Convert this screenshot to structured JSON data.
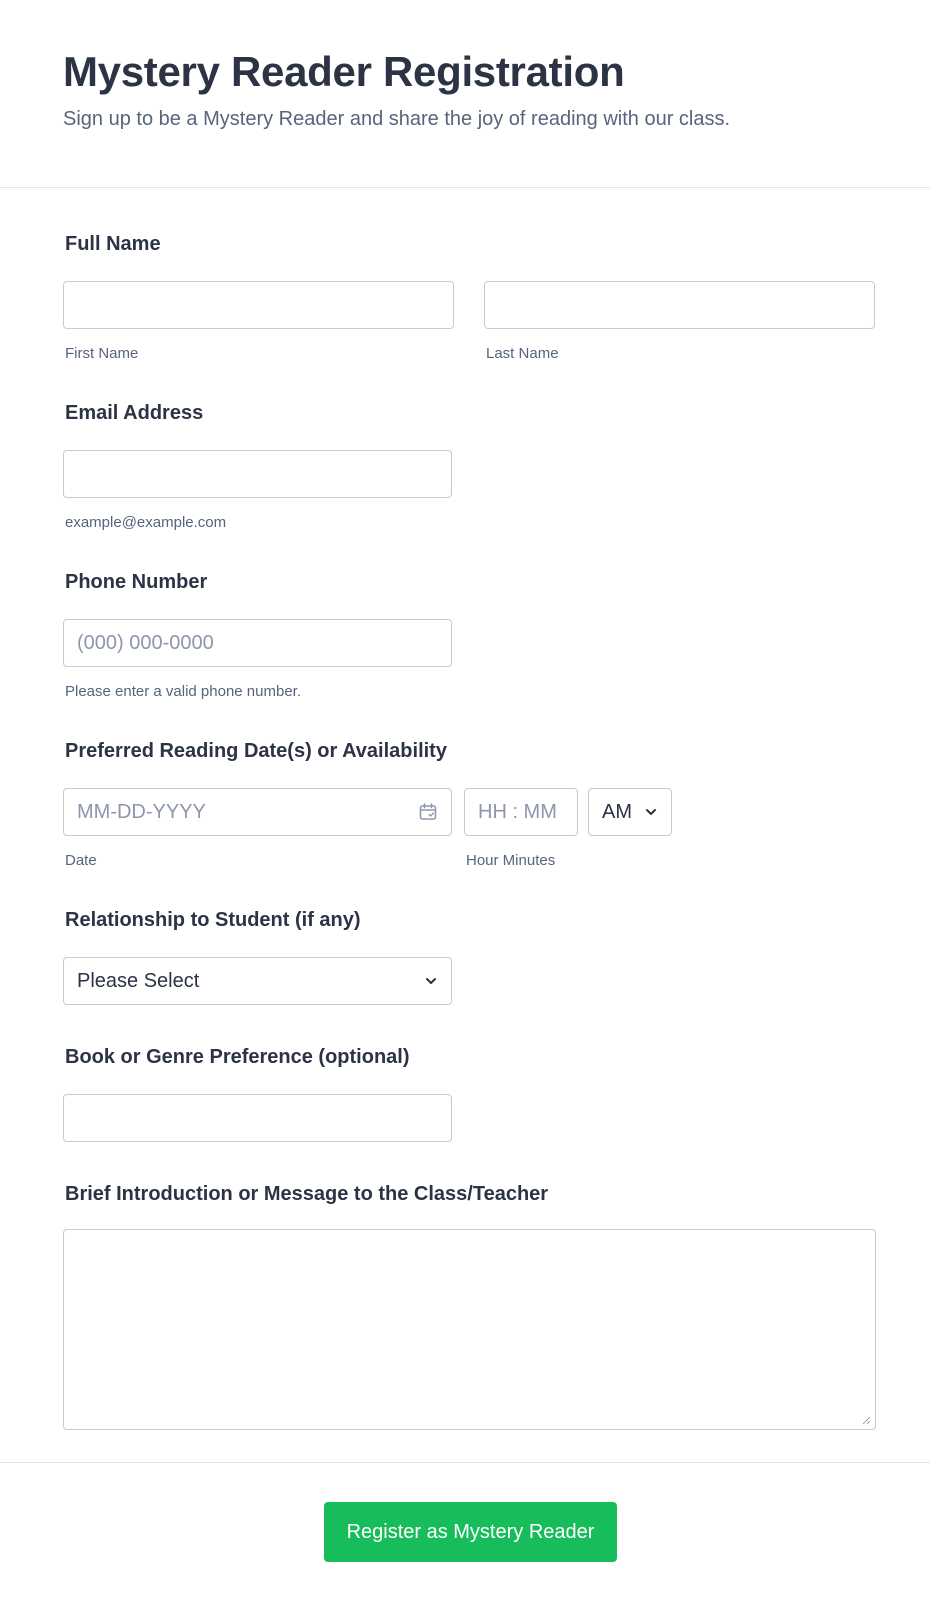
{
  "header": {
    "title": "Mystery Reader Registration",
    "subtitle": "Sign up to be a Mystery Reader and share the joy of reading with our class."
  },
  "fields": {
    "full_name": {
      "label": "Full Name",
      "first_sublabel": "First Name",
      "last_sublabel": "Last Name",
      "first_value": "",
      "last_value": ""
    },
    "email": {
      "label": "Email Address",
      "sublabel": "example@example.com",
      "value": ""
    },
    "phone": {
      "label": "Phone Number",
      "placeholder": "(000) 000-0000",
      "sublabel": "Please enter a valid phone number.",
      "value": ""
    },
    "reading_date": {
      "label": "Preferred Reading Date(s) or Availability",
      "date_placeholder": "MM-DD-YYYY",
      "date_sublabel": "Date",
      "time_placeholder": "HH : MM",
      "time_sublabel": "Hour Minutes",
      "ampm_value": "AM",
      "calendar_icon": "calendar-icon"
    },
    "relationship": {
      "label": "Relationship to Student (if any)",
      "selected": "Please Select"
    },
    "book_pref": {
      "label": "Book or Genre Preference (optional)",
      "value": ""
    },
    "message": {
      "label": "Brief Introduction or Message to the Class/Teacher",
      "value": ""
    }
  },
  "submit": {
    "label": "Register as Mystery Reader",
    "color": "#18bd5b"
  },
  "colors": {
    "text": "#2c3345",
    "muted": "#57647e",
    "border": "#c3cad8",
    "placeholder": "#8d96ac"
  }
}
